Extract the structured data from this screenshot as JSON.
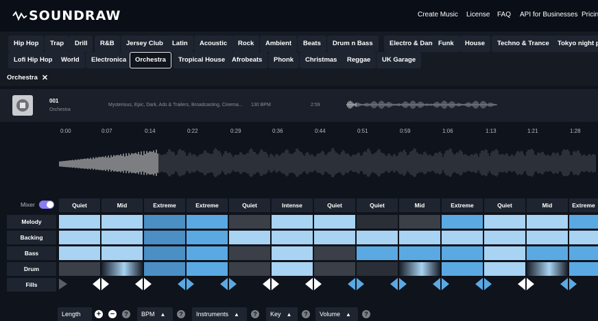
{
  "app": {
    "name": "SOUNDRAW"
  },
  "nav": [
    "Create Music",
    "License",
    "FAQ",
    "API for Businesses",
    "Pricing"
  ],
  "genres_row1": [
    "Hip Hop",
    "Trap",
    "Drill",
    "R&B",
    "Jersey Club",
    "Latin",
    "Acoustic",
    "Rock",
    "Ambient",
    "Beats",
    "Drum n Bass",
    "Electro & Dance",
    "Funk",
    "House",
    "Techno & Trance",
    "Tokyo night pop"
  ],
  "genres_row2": [
    "Lofi Hip Hop",
    "World",
    "Electronica",
    "Orchestra",
    "Tropical House",
    "Afrobeats",
    "Phonk",
    "Christmas",
    "Reggae",
    "UK Garage"
  ],
  "selected_genre": "Orchestra",
  "filter_chip": {
    "label": "Orchestra",
    "close": "✕"
  },
  "track": {
    "number": "001",
    "genre": "Orchestra",
    "tags": "Mysterious, Epic, Dark, Ads & Trailers, Broadcasting, Cinema...",
    "bpm": "130 BPM",
    "length": "2:59"
  },
  "timeline": [
    "0:00",
    "0:07",
    "0:14",
    "0:22",
    "0:29",
    "0:36",
    "0:44",
    "0:51",
    "0:59",
    "1:06",
    "1:13",
    "1:21",
    "1:28"
  ],
  "mixer": {
    "label": "Mixer",
    "enabled": true
  },
  "energy": [
    "Quiet",
    "Mid",
    "Extreme",
    "Extreme",
    "Quiet",
    "Intense",
    "Quiet",
    "Quiet",
    "Mid",
    "Extreme",
    "Quiet",
    "Mid",
    "Extreme"
  ],
  "rows": [
    "Melody",
    "Backing",
    "Bass",
    "Drum",
    "Fills"
  ],
  "colors": {
    "accent": "#8a7cf0",
    "light_block": "#a8d3f2",
    "mid_block": "#5aa9e3",
    "deep_block": "#4b8fc4",
    "empty_block": "#3b3f48",
    "background": "#0f131b"
  },
  "controls": {
    "length": "Length",
    "bpm": "BPM",
    "instruments": "Instruments",
    "key": "Key",
    "volume": "Volume",
    "up_arrow": "▲",
    "help": "?",
    "plus": "+",
    "minus": "−"
  }
}
